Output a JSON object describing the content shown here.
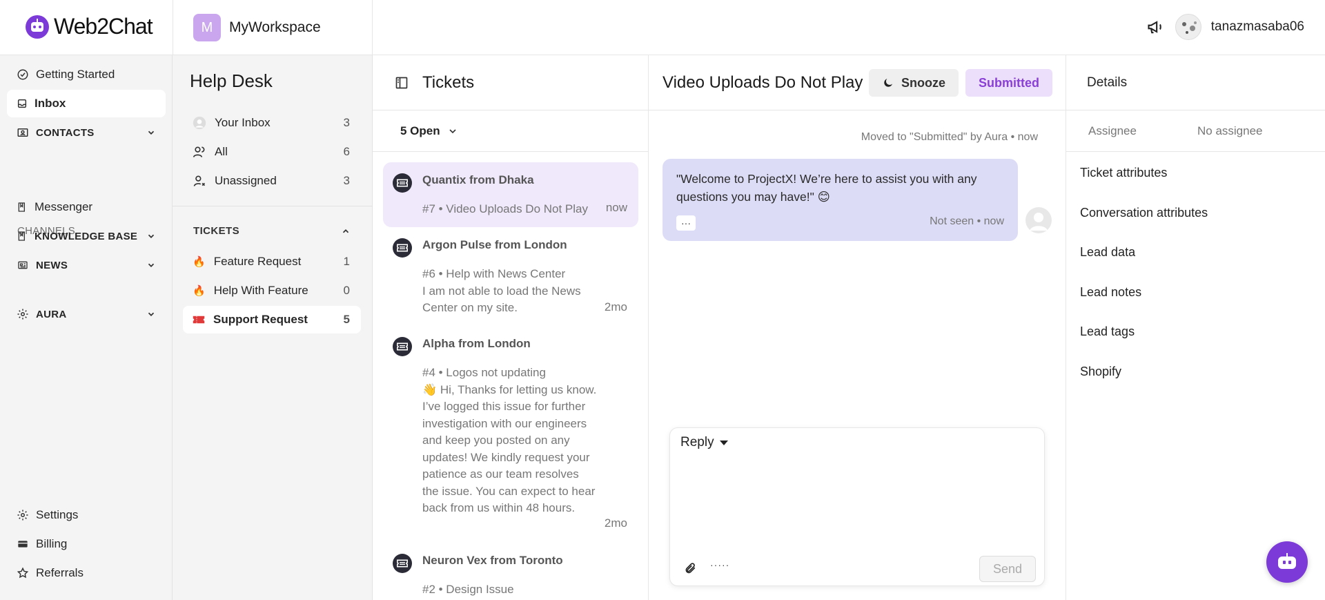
{
  "app": {
    "logo_text": "Web2Chat",
    "brand_color": "#7c3ad8"
  },
  "workspace": {
    "initial": "M",
    "name": "MyWorkspace"
  },
  "user": {
    "name": "tanazmasaba06"
  },
  "nav": {
    "getting_started": "Getting Started",
    "inbox": "Inbox",
    "contacts": "CONTACTS",
    "channels_label": "CHANNELS",
    "messenger": "Messenger",
    "knowledge_base": "KNOWLEDGE BASE",
    "news": "NEWS",
    "aura": "AURA",
    "settings": "Settings",
    "billing": "Billing",
    "referrals": "Referrals"
  },
  "helpdesk": {
    "title": "Help Desk",
    "views": [
      {
        "label": "Your Inbox",
        "count": "3"
      },
      {
        "label": "All",
        "count": "6"
      },
      {
        "label": "Unassigned",
        "count": "3"
      }
    ],
    "tickets_label": "TICKETS",
    "ticket_types": [
      {
        "label": "Feature Request",
        "count": "1"
      },
      {
        "label": "Help With Feature",
        "count": "0"
      },
      {
        "label": "Support Request",
        "count": "5"
      }
    ]
  },
  "ticket_list": {
    "title": "Tickets",
    "filter": "5 Open",
    "items": [
      {
        "name": "Quantix from Dhaka",
        "summary": "#7 • Video Uploads Do Not Play",
        "time": "now"
      },
      {
        "name": "Argon Pulse from London",
        "summary": "#6 • Help with News Center\nI am not able to load the News Center on my site.",
        "time": "2mo"
      },
      {
        "name": "Alpha from London",
        "summary": "#4 • Logos not updating\n👋 Hi, Thanks for letting us know. I’ve logged this issue for further investigation with our engineers and keep you posted on any updates! We kindly request your patience as our team resolves the issue. You can expect to hear back from us within 48 hours.",
        "time": "2mo"
      },
      {
        "name": "Neuron Vex from Toronto",
        "summary": "#2 • Design Issue",
        "time": ""
      }
    ]
  },
  "conversation": {
    "title": "Video Uploads Do Not Play",
    "snooze_label": "Snooze",
    "status_label": "Submitted",
    "system_message": "Moved to \"Submitted\" by Aura • now",
    "message_text": "\"Welcome to ProjectX! We’re here to assist you with any questions you may have!\" 😊",
    "message_more": "···",
    "message_meta": "Not seen • now",
    "reply_tab": "Reply",
    "reply_dots": "·····",
    "send_label": "Send"
  },
  "details": {
    "title": "Details",
    "assignee_label": "Assignee",
    "assignee_value": "No assignee",
    "sections": [
      "Ticket attributes",
      "Conversation attributes",
      "Lead data",
      "Lead notes",
      "Lead tags",
      "Shopify"
    ]
  }
}
